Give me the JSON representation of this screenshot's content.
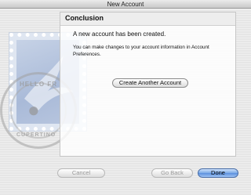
{
  "window": {
    "title": "New Account"
  },
  "panel": {
    "heading": "Conclusion",
    "message": "A new account has been created.",
    "detail": "You can make changes to your account information in Account Preferences.",
    "create_button": "Create Another Account"
  },
  "stamp": {
    "postmark_top": "HELLO FR",
    "postmark_bottom": "CUPERTINO"
  },
  "footer": {
    "cancel": "Cancel",
    "back": "Go Back",
    "done": "Done"
  },
  "colors": {
    "accent": "#5b90dd"
  }
}
